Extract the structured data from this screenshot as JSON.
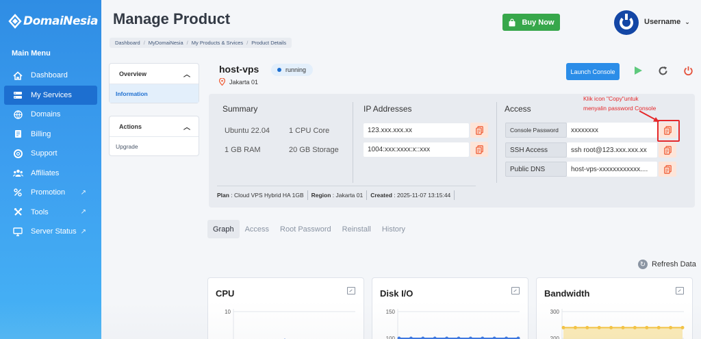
{
  "brand": {
    "name": "DomaiNesia"
  },
  "sidebar": {
    "heading": "Main Menu",
    "items": [
      {
        "label": "Dashboard",
        "icon": "home-icon"
      },
      {
        "label": "My Services",
        "icon": "server-icon",
        "active": true
      },
      {
        "label": "Domains",
        "icon": "globe-icon"
      },
      {
        "label": "Billing",
        "icon": "billing-icon"
      },
      {
        "label": "Support",
        "icon": "lifebuoy-icon"
      },
      {
        "label": "Affiliates",
        "icon": "users-icon"
      },
      {
        "label": "Promotion",
        "icon": "percent-icon",
        "external": true
      },
      {
        "label": "Tools",
        "icon": "tools-icon",
        "external": true
      },
      {
        "label": "Server Status",
        "icon": "monitor-icon",
        "external": true
      }
    ]
  },
  "header": {
    "title": "Manage Product",
    "breadcrumb": [
      "Dashboard",
      "MyDomaiNesia",
      "My Products & Srvices",
      "Product Details"
    ],
    "buy_label": "Buy Now",
    "username": "Username"
  },
  "left_panels": {
    "overview": {
      "title": "Overview",
      "items": [
        "Information"
      ]
    },
    "actions": {
      "title": "Actions",
      "items": [
        "Upgrade"
      ]
    }
  },
  "product": {
    "name": "host-vps",
    "status": "running",
    "location": "Jakarta 01",
    "launch_label": "Launch Console"
  },
  "summary": {
    "title": "Summary",
    "os": "Ubuntu 22.04",
    "cpu": "1 CPU Core",
    "ram": "1 GB RAM",
    "storage": "20 GB Storage"
  },
  "ip": {
    "title": "IP Addresses",
    "ipv4": "123.xxx.xxx.xx",
    "ipv6": "1004:xxx:xxxx:x::xxx"
  },
  "access": {
    "title": "Access",
    "rows": [
      {
        "label": "Console Password",
        "value": "xxxxxxxx"
      },
      {
        "label": "SSH Access",
        "value": "ssh root@123.xxx.xxx.xx"
      },
      {
        "label": "Public DNS",
        "value": "host-vps-xxxxxxxxxxxx...."
      }
    ]
  },
  "plan": {
    "plan_label": "Plan",
    "plan_value": "Cloud VPS Hybrid HA 1GB",
    "region_label": "Region",
    "region_value": "Jakarta 01",
    "created_label": "Created",
    "created_value": "2025-11-07 13:15:44"
  },
  "annotation": {
    "line1": "Klik icon \"Copy\"untuk",
    "line2": "menyalin password Console"
  },
  "tabs": [
    "Graph",
    "Access",
    "Root Password",
    "Reinstall",
    "History"
  ],
  "refresh_label": "Refresh Data",
  "graphs": [
    {
      "title": "CPU"
    },
    {
      "title": "Disk I/O"
    },
    {
      "title": "Bandwidth"
    }
  ],
  "colors": {
    "sidebar": "#3d9ff0",
    "accent": "#1d6fd0",
    "buy": "#37a74b",
    "copy_icon": "#f0613a",
    "annotation": "#e5282a",
    "play": "#5ec97d",
    "power": "#e5533d"
  },
  "chart_data": [
    {
      "type": "line",
      "title": "CPU",
      "y_ticks": [
        10
      ],
      "series": []
    },
    {
      "type": "line",
      "title": "Disk I/O",
      "y_ticks": [
        150,
        100
      ],
      "series": [
        {
          "values": [
            100,
            100,
            100,
            100,
            100,
            100,
            100,
            100,
            100,
            100,
            100
          ]
        }
      ]
    },
    {
      "type": "area",
      "title": "Bandwidth",
      "y_ticks": [
        300,
        200
      ],
      "series": [
        {
          "values": [
            240,
            240,
            240,
            240,
            240,
            240,
            240,
            240,
            240,
            240,
            240
          ]
        }
      ]
    }
  ]
}
